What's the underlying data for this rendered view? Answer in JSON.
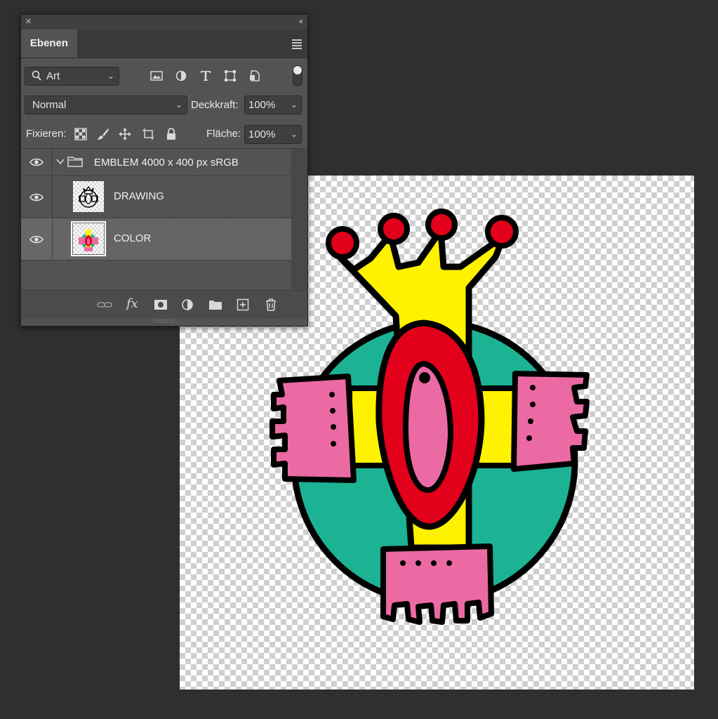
{
  "colors": {
    "workspace": "#2f2f2f",
    "panel": "#535353",
    "emblem_teal": "#1bb394",
    "emblem_yellow": "#fff200",
    "emblem_red": "#e2001a",
    "emblem_pink": "#ec6aa4",
    "emblem_outline": "#000000"
  },
  "panel": {
    "close_icon": "close-icon",
    "collapse_icon": "double-chevron-left-icon",
    "tab_label": "Ebenen",
    "menu_icon": "hamburger-menu-icon",
    "filter": {
      "icon": "search-icon",
      "value": "Art"
    },
    "filter_icons": [
      "image-filter-icon",
      "adjustment-filter-icon",
      "type-filter-icon",
      "shape-filter-icon",
      "smart-object-filter-icon"
    ],
    "blend_mode": "Normal",
    "opacity_label": "Deckkraft:",
    "opacity_value": "100%",
    "lock_label": "Fixieren:",
    "lock_icons": [
      "lock-transparent-icon",
      "lock-paint-icon",
      "lock-position-icon",
      "lock-artboard-icon",
      "lock-all-icon"
    ],
    "fill_label": "Fläche:",
    "fill_value": "100%",
    "layers": [
      {
        "name": "EMBLEM 4000 x 400 px sRGB",
        "type": "group",
        "visible": true,
        "expanded": true
      },
      {
        "name": "DRAWING",
        "type": "layer",
        "visible": true,
        "selected": false
      },
      {
        "name": "COLOR",
        "type": "layer",
        "visible": true,
        "selected": true
      }
    ],
    "footer_icons": [
      "link-layers-icon",
      "fx-icon",
      "add-mask-icon",
      "adjustment-layer-icon",
      "new-group-icon",
      "new-layer-icon",
      "trash-icon"
    ],
    "fx_label": "fx"
  }
}
